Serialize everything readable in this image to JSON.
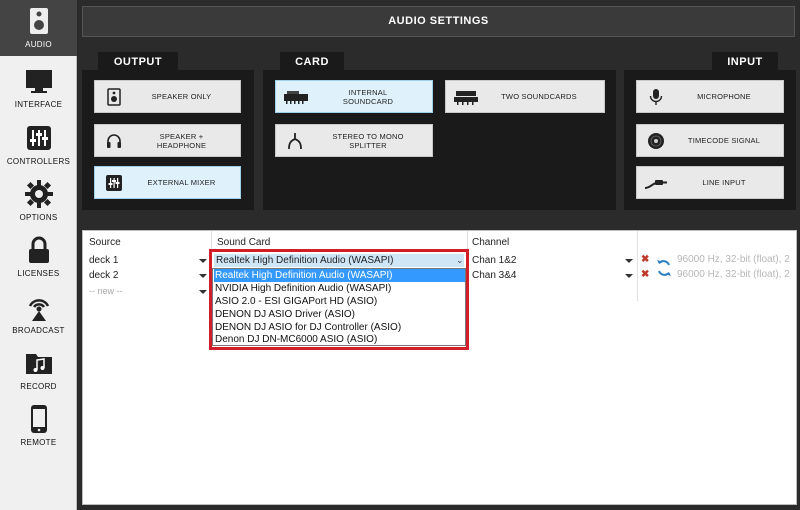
{
  "sidebar": {
    "items": [
      {
        "label": "AUDIO",
        "icon": "speaker-icon",
        "active": true
      },
      {
        "label": "INTERFACE",
        "icon": "monitor-icon"
      },
      {
        "label": "CONTROLLERS",
        "icon": "sliders-icon"
      },
      {
        "label": "OPTIONS",
        "icon": "gear-icon"
      },
      {
        "label": "LICENSES",
        "icon": "lock-icon"
      },
      {
        "label": "BROADCAST",
        "icon": "broadcast-icon"
      },
      {
        "label": "RECORD",
        "icon": "music-folder-icon"
      },
      {
        "label": "REMOTE",
        "icon": "phone-icon"
      }
    ]
  },
  "header": {
    "title": "AUDIO SETTINGS"
  },
  "output": {
    "tab": "OUTPUT",
    "buttons": [
      {
        "label": "SPEAKER ONLY",
        "icon": "speaker-icon"
      },
      {
        "label": "SPEAKER +\nHEADPHONE",
        "icon": "headphone-icon"
      },
      {
        "label": "EXTERNAL MIXER",
        "icon": "mixer-icon",
        "selected": true
      }
    ]
  },
  "card": {
    "tab": "CARD",
    "buttons": [
      {
        "label": "INTERNAL\nSOUNDCARD",
        "icon": "soundcard-icon",
        "selected": true
      },
      {
        "label": "TWO SOUNDCARDS",
        "icon": "two-soundcards-icon"
      },
      {
        "label": "STEREO TO MONO\nSPLITTER",
        "icon": "splitter-cable-icon"
      }
    ]
  },
  "input": {
    "tab": "INPUT",
    "buttons": [
      {
        "label": "MICROPHONE",
        "icon": "microphone-icon"
      },
      {
        "label": "TIMECODE SIGNAL",
        "icon": "vinyl-icon"
      },
      {
        "label": "LINE INPUT",
        "icon": "cable-icon"
      }
    ]
  },
  "table": {
    "headers": {
      "source": "Source",
      "soundcard": "Sound Card",
      "channel": "Channel"
    },
    "rows": [
      {
        "source": "deck 1",
        "soundcard": "Realtek High Definition Audio (WASAPI)",
        "channel": "Chan 1&2",
        "info": "96000 Hz, 32-bit (float), 2"
      },
      {
        "source": "deck 2",
        "soundcard": "",
        "channel": "Chan 3&4",
        "info": "96000 Hz, 32-bit (float), 2"
      }
    ],
    "new_row": "-- new --"
  },
  "dropdown": {
    "options": [
      "Realtek High Definition Audio (WASAPI)",
      "NVIDIA High Definition Audio (WASAPI)",
      "ASIO 2.0 - ESI GIGAPort HD (ASIO)",
      "DENON DJ ASIO Driver (ASIO)",
      "DENON DJ ASIO for DJ Controller (ASIO)",
      "Denon DJ DN-MC6000 ASIO (ASIO)"
    ],
    "highlighted_index": 0
  },
  "colors": {
    "highlight": "#3399ff",
    "annotation": "#d01f2b",
    "selected_button": "#dff2fb"
  }
}
